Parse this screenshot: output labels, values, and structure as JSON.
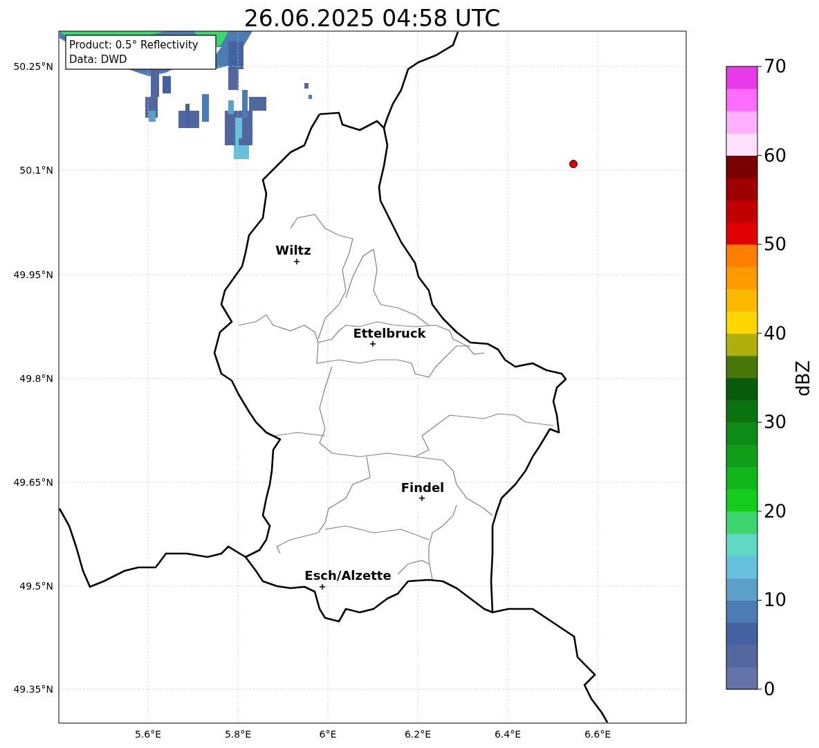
{
  "title": "26.06.2025 04:58 UTC",
  "legend": [
    "Product: 0.5° Reflectivity",
    "Data: DWD"
  ],
  "y_ticks": [
    "50.25°N",
    "50.1°N",
    "49.95°N",
    "49.8°N",
    "49.65°N",
    "49.5°N",
    "49.35°N"
  ],
  "x_ticks": [
    "5.6°E",
    "5.8°E",
    "6°E",
    "6.2°E",
    "6.4°E",
    "6.6°E"
  ],
  "cities": [
    {
      "name": "Wiltz"
    },
    {
      "name": "Ettelbruck"
    },
    {
      "name": "Findel"
    },
    {
      "name": "Esch/Alzette"
    }
  ],
  "colorbar": {
    "label": "dBZ",
    "ticks": [
      "70",
      "60",
      "50",
      "40",
      "30",
      "20",
      "10",
      "0"
    ],
    "bands": [
      {
        "color": "#6472a8"
      },
      {
        "color": "#52679e"
      },
      {
        "color": "#4461a2"
      },
      {
        "color": "#4c7cb4"
      },
      {
        "color": "#5ba0c9"
      },
      {
        "color": "#66c2dc"
      },
      {
        "color": "#5fd8c5"
      },
      {
        "color": "#3dd56e"
      },
      {
        "color": "#13cc1c"
      },
      {
        "color": "#10b71a"
      },
      {
        "color": "#0e9e17"
      },
      {
        "color": "#0b8a15"
      },
      {
        "color": "#097310"
      },
      {
        "color": "#065a0a"
      },
      {
        "color": "#477709"
      },
      {
        "color": "#b0b00a"
      },
      {
        "color": "#ffd700"
      },
      {
        "color": "#ffb800"
      },
      {
        "color": "#ff9b00"
      },
      {
        "color": "#ff7e00"
      },
      {
        "color": "#e00000"
      },
      {
        "color": "#c00000"
      },
      {
        "color": "#9c0000"
      },
      {
        "color": "#7a0000"
      },
      {
        "color": "#ffe0fe"
      },
      {
        "color": "#ffb0fe"
      },
      {
        "color": "#fd6cfd"
      },
      {
        "color": "#e83be8"
      }
    ]
  }
}
